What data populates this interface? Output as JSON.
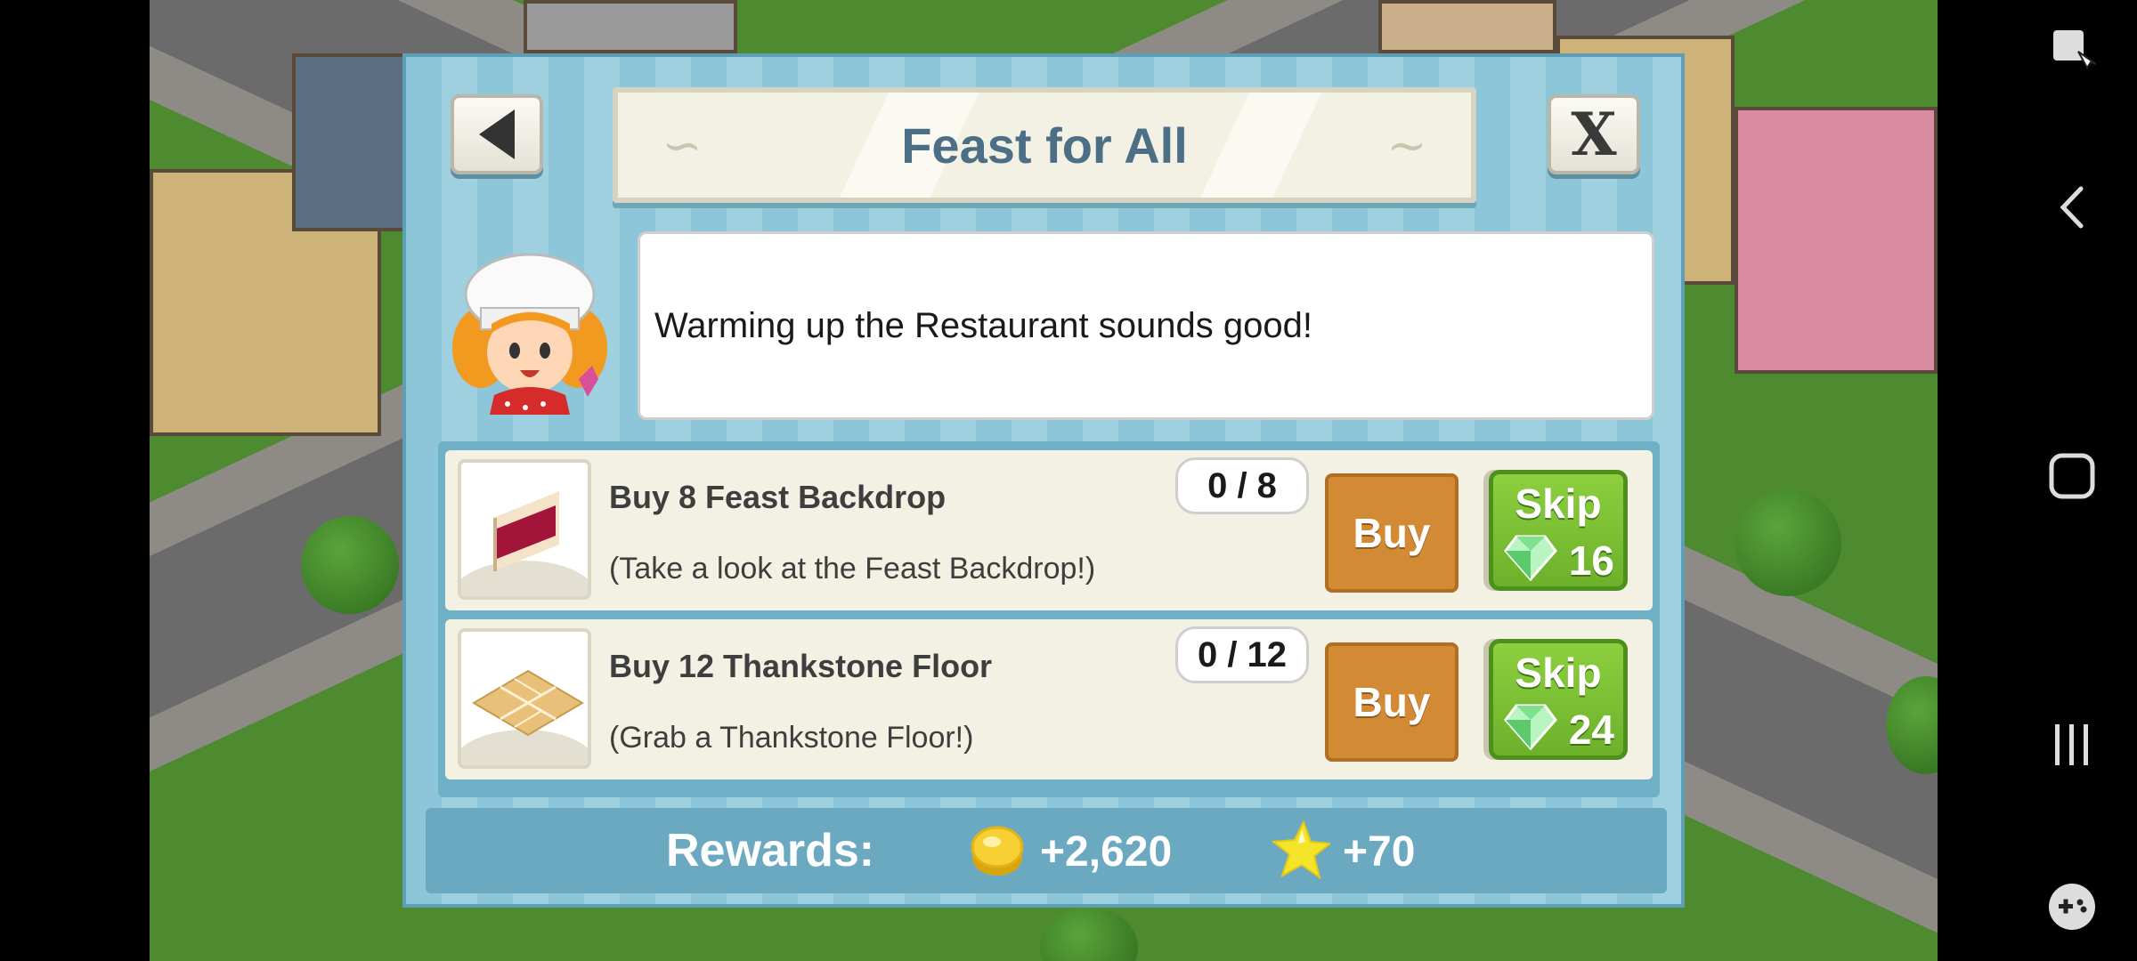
{
  "dialog": {
    "title": "Feast for All",
    "back_icon": "back-arrow-icon",
    "close_label": "X",
    "speech": "Warming up the Restaurant sounds good!"
  },
  "tasks": [
    {
      "title": "Buy 8 Feast Backdrop",
      "description": "(Take a look at the Feast Backdrop!)",
      "progress": "0 / 8",
      "buy_label": "Buy",
      "skip_label": "Skip",
      "skip_cost": "16"
    },
    {
      "title": "Buy 12 Thankstone Floor",
      "description": "(Grab a Thankstone Floor!)",
      "progress": "0 / 12",
      "buy_label": "Buy",
      "skip_label": "Skip",
      "skip_cost": "24"
    }
  ],
  "rewards": {
    "label": "Rewards:",
    "coins": "+2,620",
    "xp": "+70"
  },
  "colors": {
    "title": "#4d6f86",
    "buy": "#d38a35",
    "skip": "#7cc035",
    "panel": "#8cc6d8"
  }
}
